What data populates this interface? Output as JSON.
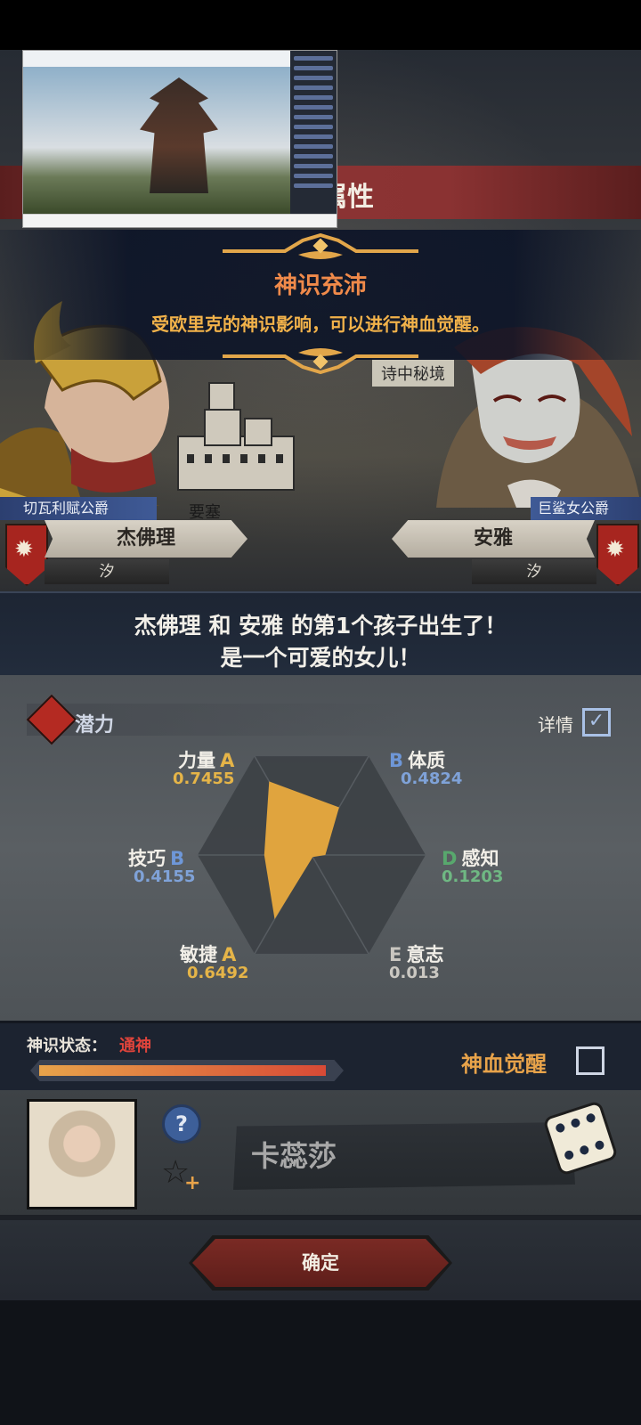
{
  "header": {
    "title": "属性"
  },
  "announcement": {
    "title": "神识充沛",
    "description": "受欧里克的神识影响，可以进行神血觉醒。"
  },
  "map": {
    "location_right": "诗中秘境",
    "location_castle": "要塞"
  },
  "parents": {
    "left": {
      "title": "切瓦利赋公爵",
      "name": "杰佛理",
      "sub": "汐"
    },
    "right": {
      "title": "巨鲨女公爵",
      "name": "安雅",
      "sub": "汐"
    }
  },
  "birth": {
    "line1": "杰佛理 和 安雅 的第1个孩子出生了！",
    "line2": "是一个可爱的女儿！"
  },
  "potential": {
    "label": "潜力",
    "detail_label": "详情",
    "detail_checked": true,
    "stats": [
      {
        "name": "力量",
        "grade": "A",
        "value": "0.7455",
        "v": 0.7455
      },
      {
        "name": "体质",
        "grade": "B",
        "value": "0.4824",
        "v": 0.4824
      },
      {
        "name": "感知",
        "grade": "D",
        "value": "0.1203",
        "v": 0.1203
      },
      {
        "name": "意志",
        "grade": "E",
        "value": "0.013",
        "v": 0.013
      },
      {
        "name": "敏捷",
        "grade": "A",
        "value": "0.6492",
        "v": 0.6492
      },
      {
        "name": "技巧",
        "grade": "B",
        "value": "0.4155",
        "v": 0.4155
      }
    ]
  },
  "status": {
    "label": "神识状态：",
    "value": "通神",
    "progress": 0.97,
    "awaken_label": "神血觉醒",
    "awaken_checked": false
  },
  "child": {
    "name": "卡蕊莎"
  },
  "confirm_label": "确定",
  "colors": {
    "accent_orange": "#e8a34a",
    "status_red": "#e0443b",
    "radar_fill": "#e0a43e",
    "grade_A": "#e5b448",
    "grade_B": "#6e97d8",
    "grade_D": "#58a86d",
    "grade_E": "#c9c6c0"
  }
}
